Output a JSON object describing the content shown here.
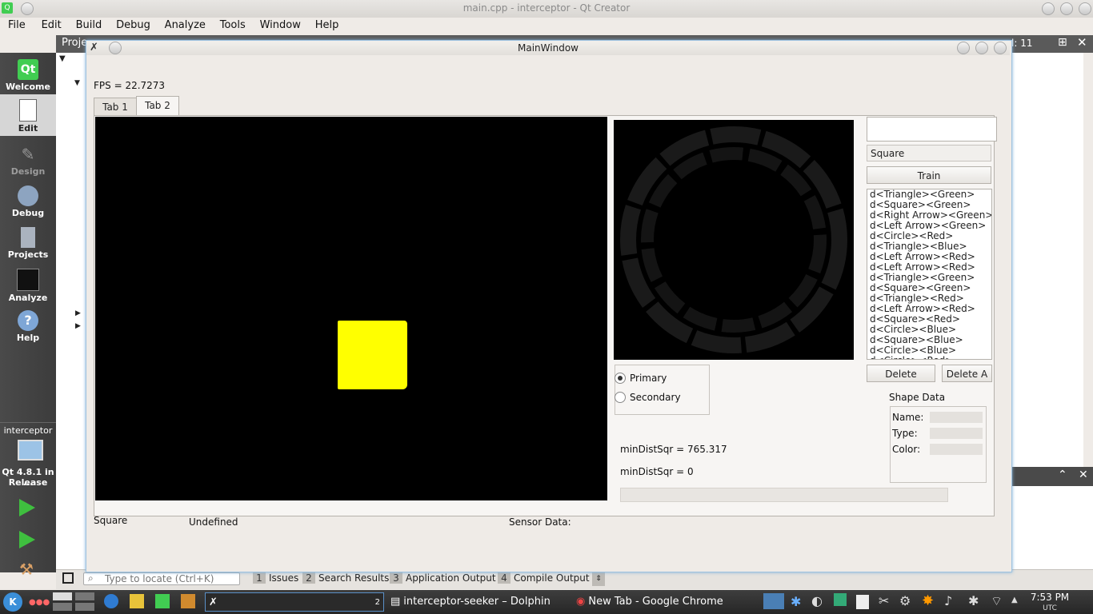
{
  "qtcreator": {
    "title": "main.cpp - interceptor - Qt Creator",
    "menu": [
      "File",
      "Edit",
      "Build",
      "Debug",
      "Analyze",
      "Tools",
      "Window",
      "Help"
    ],
    "projects_label": "Proje",
    "line_label": "l: 11",
    "modes": [
      {
        "label": "Welcome",
        "icon": "qt-logo-icon"
      },
      {
        "label": "Edit",
        "icon": "document-icon"
      },
      {
        "label": "Design",
        "icon": "design-icon"
      },
      {
        "label": "Debug",
        "icon": "bug-icon"
      },
      {
        "label": "Projects",
        "icon": "projects-icon"
      },
      {
        "label": "Analyze",
        "icon": "analyze-icon"
      },
      {
        "label": "Help",
        "icon": "help-icon"
      }
    ],
    "target": {
      "project": "interceptor",
      "kit": "Qt 4.8.1 in ...",
      "config": "Release"
    },
    "locate_placeholder": "Type to locate (Ctrl+K)",
    "output_tabs": [
      {
        "num": "1",
        "label": "Issues"
      },
      {
        "num": "2",
        "label": "Search Results"
      },
      {
        "num": "3",
        "label": "Application Output"
      },
      {
        "num": "4",
        "label": "Compile Output"
      }
    ]
  },
  "mainwindow": {
    "title": "MainWindow",
    "fps": "FPS = 22.7273",
    "tabs": [
      "Tab 1",
      "Tab 2"
    ],
    "shape_input": "",
    "shape_combo": "Square",
    "train_label": "Train",
    "shapes": [
      "d<Triangle><Green>",
      "d<Square><Green>",
      "d<Right Arrow><Green>",
      "d<Left Arrow><Green>",
      "d<Circle><Red>",
      "d<Triangle><Blue>",
      "d<Left Arrow><Red>",
      "d<Left Arrow><Red>",
      "d<Triangle><Green>",
      "d<Square><Green>",
      "d<Triangle><Red>",
      "d<Left Arrow><Red>",
      "d<Square><Red>",
      "d<Circle><Blue>",
      "d<Square><Blue>",
      "d<Circle><Blue>",
      "d<Circle><Red>"
    ],
    "delete_label": "Delete",
    "delete_all_label": "Delete A",
    "radio_primary": "Primary",
    "radio_secondary": "Secondary",
    "shape_data_title": "Shape Data",
    "shape_data_fields": {
      "name": "Name:",
      "type": "Type:",
      "color": "Color:"
    },
    "min_dist_1": "minDistSqr = 765.317",
    "min_dist_2": "minDistSqr = 0",
    "status_shape": "Square",
    "status_state": "Undefined",
    "sensor_label": "Sensor Data:"
  },
  "taskbar": {
    "tasks": [
      "interceptor-seeker – Dolphin",
      "New Tab - Google Chrome"
    ],
    "desktop_num": "2",
    "time": "7:53 PM",
    "tz": "UTC"
  },
  "colors": {
    "detected_blob": "#ffff00",
    "mode_bar": "#404040",
    "window_border": "#9fc3e0"
  }
}
